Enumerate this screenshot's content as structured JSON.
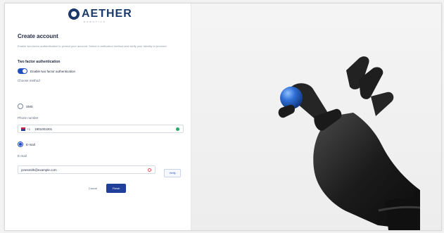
{
  "brand": {
    "name": "AETHER",
    "tagline": "ROBOTICS"
  },
  "form": {
    "title": "Create account",
    "description": "Enable two-factor authentication to protect your account. Select a verification method and verify your identity to proceed.",
    "section_title": "Two factor authentication",
    "toggle_label": "Enable two factor authentication",
    "toggle_on": true,
    "method_label": "Choose method",
    "methods": [
      {
        "label": "SMS",
        "selected": false
      },
      {
        "label": "E-mail",
        "selected": true
      }
    ],
    "phone": {
      "label": "Phone number",
      "country_code": "+1",
      "value": "1801001001"
    },
    "email": {
      "label": "E-mail",
      "value": "jonesmith@example.com",
      "verify_label": "Verify"
    },
    "cancel_label": "Cancel",
    "finish_label": "Finish"
  },
  "colors": {
    "accent": "#1f3f9a",
    "success": "#2aa86a",
    "error": "#e0554a"
  },
  "hero_image": {
    "description": "robotic hand holding blue sphere",
    "ball_color": "#2f6fd6"
  }
}
